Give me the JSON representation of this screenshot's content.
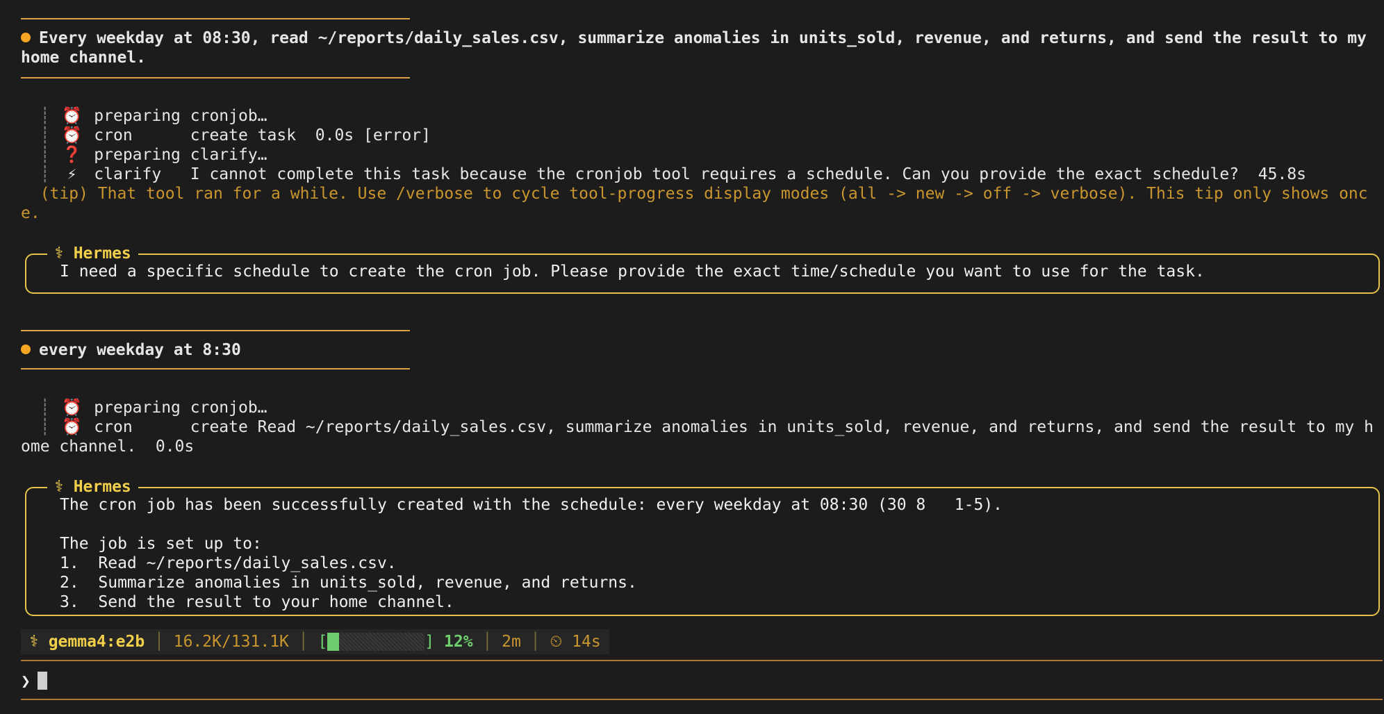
{
  "message1": {
    "line1": "Every weekday at 08:30, read ~/reports/daily_sales.csv, summarize anomalies in units_sold, revenue, and returns, and send the result to my",
    "line2": "home channel."
  },
  "tools1": [
    {
      "icon": "⏰",
      "icon_name": "alarm-clock-icon",
      "text": "preparing cronjob…"
    },
    {
      "icon": "⏰",
      "icon_name": "alarm-clock-icon",
      "text": "cron      create task  0.0s [error]"
    },
    {
      "icon": "❓",
      "icon_name": "question-icon",
      "text": "preparing clarify…"
    },
    {
      "icon": "⚡",
      "icon_name": "lightning-icon",
      "text": "clarify   I cannot complete this task because the cronjob tool requires a schedule. Can you provide the exact schedule?  45.8s"
    }
  ],
  "tip": {
    "line1": "(tip) That tool ran for a while. Use /verbose to cycle tool-progress display modes (all -> new -> off -> verbose). This tip only shows onc",
    "line2": "e."
  },
  "response1": {
    "title": "⚕ Hermes",
    "lines": [
      "I need a specific schedule to create the cron job. Please provide the exact time/schedule you want to use for the task."
    ]
  },
  "message2": {
    "line1": "every weekday at 8:30"
  },
  "tools2": [
    {
      "icon": "⏰",
      "icon_name": "alarm-clock-icon",
      "text": "preparing cronjob…"
    },
    {
      "icon": "⏰",
      "icon_name": "alarm-clock-icon",
      "text": "cron      create Read ~/reports/daily_sales.csv, summarize anomalies in units_sold, revenue, and returns, and send the result to my h"
    }
  ],
  "tools2_wrap": "ome channel.  0.0s",
  "response2": {
    "title": "⚕ Hermes",
    "lines": [
      "The cron job has been successfully created with the schedule: every weekday at 08:30 (30 8   1-5).",
      "",
      "The job is set up to:",
      "1.  Read ~/reports/daily_sales.csv.",
      "2.  Summarize anomalies in units_sold, revenue, and returns.",
      "3.  Send the result to your home channel."
    ]
  },
  "status": {
    "model": "⚕ gemma4:e2b",
    "tokens": "16.2K/131.1K",
    "context_fill": 0.12,
    "percent": "12%",
    "duration": "2m",
    "timer": "⏲ 14s"
  },
  "prompt": {
    "symbol": "❯"
  },
  "colors": {
    "accent": "#f5a623",
    "panel_border": "#e6c34a",
    "tip": "#c9952e",
    "progress": "#6fcf6f",
    "background": "#1c1c1c"
  }
}
